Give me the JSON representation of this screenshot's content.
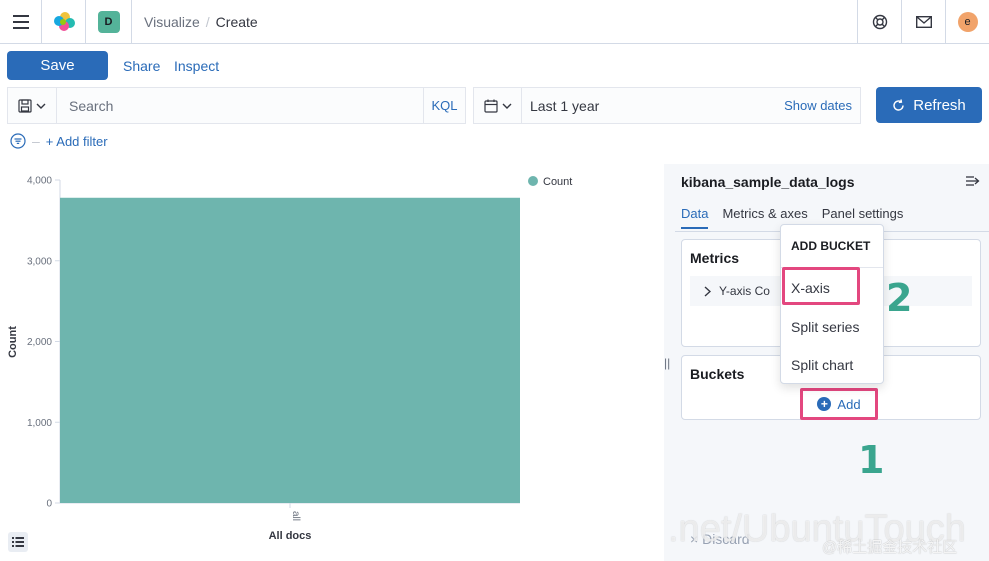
{
  "header": {
    "space_initial": "D",
    "breadcrumb_parent": "Visualize",
    "breadcrumb_current": "Create",
    "user_initial": "e",
    "icons": [
      "menu-icon",
      "elastic-logo",
      "help-icon",
      "mail-icon"
    ]
  },
  "toolbar": {
    "save_label": "Save",
    "share_label": "Share",
    "inspect_label": "Inspect"
  },
  "query": {
    "search_placeholder": "Search",
    "language": "KQL",
    "time_range": "Last 1 year",
    "show_dates": "Show dates",
    "refresh_label": "Refresh",
    "add_filter": "+ Add filter"
  },
  "chart_data": {
    "type": "bar",
    "categories": [
      "All docs"
    ],
    "category_ticks": [
      "all"
    ],
    "series": [
      {
        "name": "Count",
        "values": [
          3780
        ]
      }
    ],
    "xlabel": "All docs",
    "ylabel": "Count",
    "yticks": [
      "0",
      "1,000",
      "2,000",
      "3,000",
      "4,000"
    ],
    "ylim": [
      0,
      4000
    ],
    "legend_position": "top-right",
    "color": "#6eb5ae"
  },
  "sidebar": {
    "index_name": "kibana_sample_data_logs",
    "tabs": [
      {
        "label": "Data",
        "active": true
      },
      {
        "label": "Metrics & axes",
        "active": false
      },
      {
        "label": "Panel settings",
        "active": false
      }
    ],
    "metrics_title": "Metrics",
    "metric_row": "Y-axis Co",
    "buckets_title": "Buckets",
    "add_label": "Add",
    "discard_label": "Discard"
  },
  "popover": {
    "title": "ADD BUCKET",
    "items": [
      "X-axis",
      "Split series",
      "Split chart"
    ]
  },
  "annotations": {
    "step1": "1",
    "step2": "2",
    "highlight_color": "#e3477f",
    "step_color": "#3aa58e"
  },
  "watermark": {
    "text": ".net/UbuntuTouch",
    "credit": "@稀土掘金技术社区"
  }
}
